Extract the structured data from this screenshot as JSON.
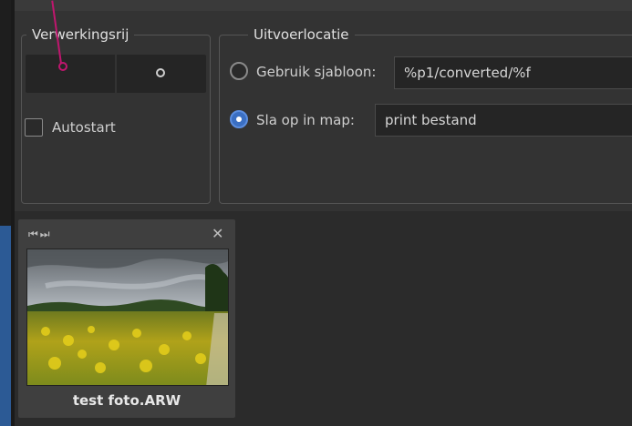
{
  "processing_queue": {
    "legend": "Verwerkingsrij",
    "autostart_label": "Autostart",
    "autostart_checked": false
  },
  "output_location": {
    "legend": "Uitvoerlocatie",
    "use_template_label": "Gebruik sjabloon:",
    "template_value": "%p1/converted/%f",
    "save_in_folder_label": "Sla op in map:",
    "folder_value": "print bestand",
    "selected_option": "save_in_folder"
  },
  "thumbnail": {
    "filename": "test foto.ARW",
    "nav_icons": "first-last-icon",
    "close_icon": "close-icon"
  },
  "colors": {
    "accent": "#3b6fc2",
    "annotation": "#c0166e",
    "sidebar_blue": "#2c5a95"
  }
}
